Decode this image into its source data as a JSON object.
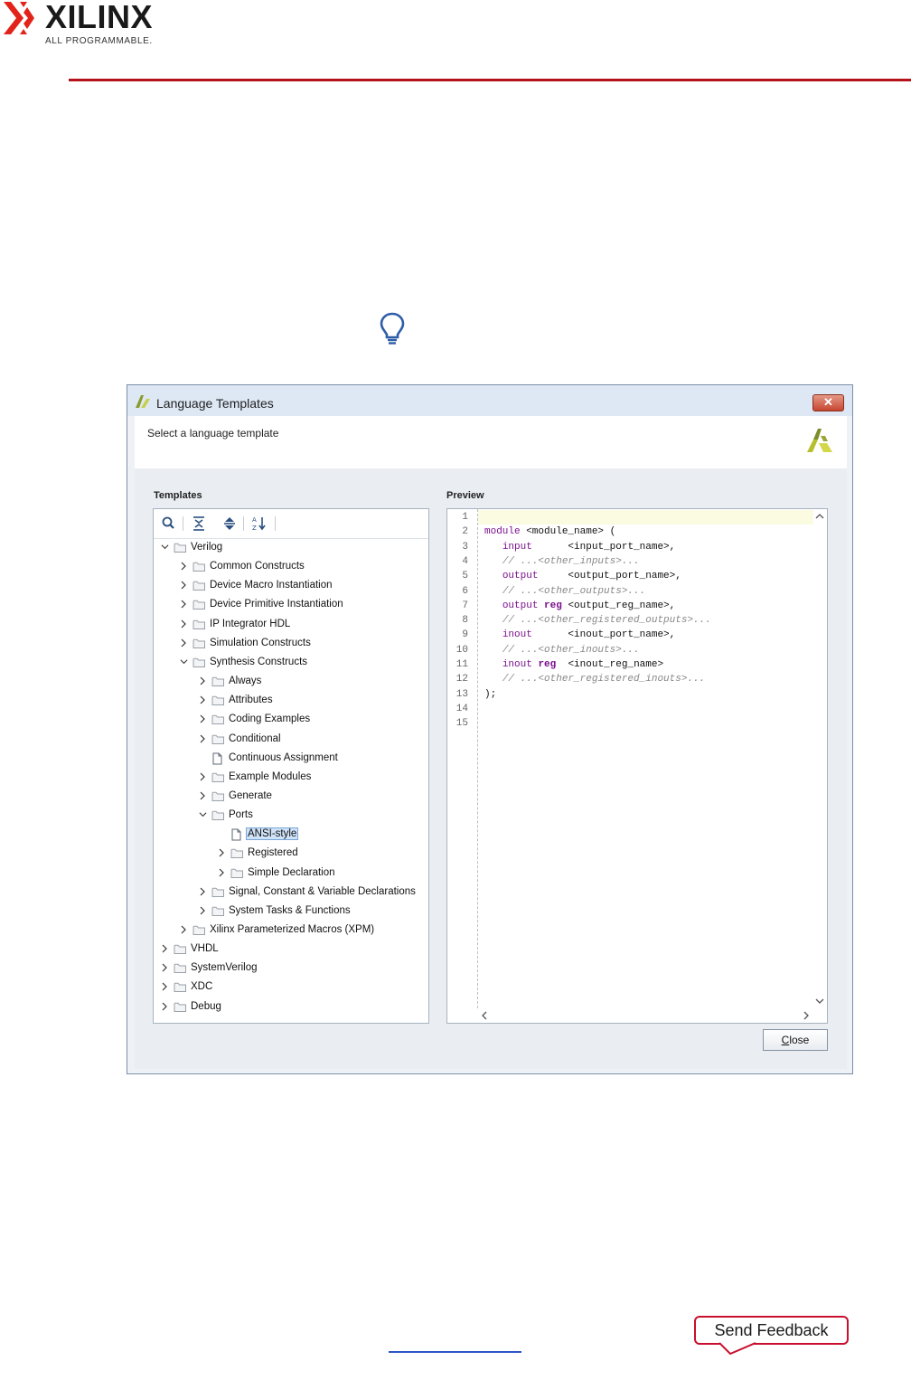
{
  "page": {
    "brand_name": "XILINX",
    "brand_tagline": "ALL PROGRAMMABLE.",
    "send_feedback_label": "Send Feedback",
    "tip_icon": "lightbulb-icon"
  },
  "dialog": {
    "title": "Language Templates",
    "description": "Select a language template",
    "templates_label": "Templates",
    "preview_label": "Preview",
    "close_label": "Close",
    "close_mnemonic": "C",
    "close_rest": "lose"
  },
  "toolbar": [
    "search-icon",
    "collapse-all-icon",
    "expand-all-icon",
    "sort-icon"
  ],
  "tree": [
    {
      "label": "Verilog",
      "depth": 0,
      "type": "folder",
      "expanded": true
    },
    {
      "label": "Common Constructs",
      "depth": 1,
      "type": "folder",
      "expanded": false
    },
    {
      "label": "Device Macro Instantiation",
      "depth": 1,
      "type": "folder",
      "expanded": false
    },
    {
      "label": "Device Primitive Instantiation",
      "depth": 1,
      "type": "folder",
      "expanded": false
    },
    {
      "label": "IP Integrator HDL",
      "depth": 1,
      "type": "folder",
      "expanded": false
    },
    {
      "label": "Simulation Constructs",
      "depth": 1,
      "type": "folder",
      "expanded": false
    },
    {
      "label": "Synthesis Constructs",
      "depth": 1,
      "type": "folder",
      "expanded": true
    },
    {
      "label": "Always",
      "depth": 2,
      "type": "folder",
      "expanded": false
    },
    {
      "label": "Attributes",
      "depth": 2,
      "type": "folder",
      "expanded": false
    },
    {
      "label": "Coding Examples",
      "depth": 2,
      "type": "folder",
      "expanded": false
    },
    {
      "label": "Conditional",
      "depth": 2,
      "type": "folder",
      "expanded": false
    },
    {
      "label": "Continuous Assignment",
      "depth": 2,
      "type": "file"
    },
    {
      "label": "Example Modules",
      "depth": 2,
      "type": "folder",
      "expanded": false
    },
    {
      "label": "Generate",
      "depth": 2,
      "type": "folder",
      "expanded": false
    },
    {
      "label": "Ports",
      "depth": 2,
      "type": "folder",
      "expanded": true
    },
    {
      "label": "ANSI-style",
      "depth": 3,
      "type": "file",
      "selected": true
    },
    {
      "label": "Registered",
      "depth": 3,
      "type": "folder",
      "expanded": false
    },
    {
      "label": "Simple Declaration",
      "depth": 3,
      "type": "folder",
      "expanded": false
    },
    {
      "label": "Signal, Constant & Variable Declarations",
      "depth": 2,
      "type": "folder",
      "expanded": false
    },
    {
      "label": "System Tasks & Functions",
      "depth": 2,
      "type": "folder",
      "expanded": false
    },
    {
      "label": "Xilinx Parameterized Macros (XPM)",
      "depth": 1,
      "type": "folder",
      "expanded": false
    },
    {
      "label": "VHDL",
      "depth": 0,
      "type": "folder",
      "expanded": false
    },
    {
      "label": "SystemVerilog",
      "depth": 0,
      "type": "folder",
      "expanded": false
    },
    {
      "label": "XDC",
      "depth": 0,
      "type": "folder",
      "expanded": false
    },
    {
      "label": "Debug",
      "depth": 0,
      "type": "folder",
      "expanded": false
    }
  ],
  "code_lines": [
    [],
    [
      [
        "kw",
        "module"
      ],
      [
        "p",
        " <module_name> ("
      ]
    ],
    [
      [
        "p",
        "   "
      ],
      [
        "kw",
        "input"
      ],
      [
        "p",
        "      <input_port_name>,"
      ]
    ],
    [
      [
        "p",
        "   "
      ],
      [
        "cm",
        "// ...<other_inputs>..."
      ]
    ],
    [
      [
        "p",
        "   "
      ],
      [
        "kw",
        "output"
      ],
      [
        "p",
        "     <output_port_name>,"
      ]
    ],
    [
      [
        "p",
        "   "
      ],
      [
        "cm",
        "// ...<other_outputs>..."
      ]
    ],
    [
      [
        "p",
        "   "
      ],
      [
        "kw",
        "output"
      ],
      [
        "p",
        " "
      ],
      [
        "kwb",
        "reg"
      ],
      [
        "p",
        " <output_reg_name>,"
      ]
    ],
    [
      [
        "p",
        "   "
      ],
      [
        "cm",
        "// ...<other_registered_outputs>..."
      ]
    ],
    [
      [
        "p",
        "   "
      ],
      [
        "kw",
        "inout"
      ],
      [
        "p",
        "      <inout_port_name>,"
      ]
    ],
    [
      [
        "p",
        "   "
      ],
      [
        "cm",
        "// ...<other_inouts>..."
      ]
    ],
    [
      [
        "p",
        "   "
      ],
      [
        "kw",
        "inout"
      ],
      [
        "p",
        " "
      ],
      [
        "kwb",
        "reg"
      ],
      [
        "p",
        "  <inout_reg_name>"
      ]
    ],
    [
      [
        "p",
        "   "
      ],
      [
        "cm",
        "// ...<other_registered_inouts>..."
      ]
    ],
    [
      [
        "p",
        ");"
      ]
    ],
    [],
    []
  ],
  "colors": {
    "brand_red": "#e2231a",
    "header_rule": "#b5121b",
    "keyword": "#7a0e8c",
    "comment": "#888888",
    "selection": "#cfe2f8"
  }
}
